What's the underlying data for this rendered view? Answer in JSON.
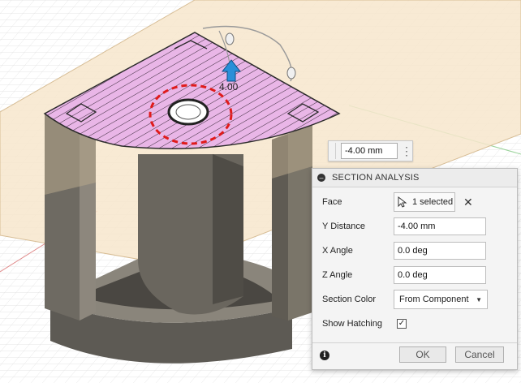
{
  "viewport": {
    "dimension_label": "4.00"
  },
  "distance_input": {
    "value": "-4.00 mm",
    "menu_icon": "vertical-ellipsis-icon"
  },
  "dialog": {
    "title": "SECTION ANALYSIS",
    "face": {
      "label": "Face",
      "selected_text": "1 selected",
      "clear_icon": "close-icon"
    },
    "y_distance": {
      "label": "Y Distance",
      "value": "-4.00 mm"
    },
    "x_angle": {
      "label": "X Angle",
      "value": "0.0 deg"
    },
    "z_angle": {
      "label": "Z Angle",
      "value": "0.0 deg"
    },
    "section_color": {
      "label": "Section Color",
      "value": "From Component"
    },
    "show_hatching": {
      "label": "Show Hatching",
      "checked": true
    },
    "ok_label": "OK",
    "cancel_label": "Cancel"
  },
  "colors": {
    "section_face": "#e8b4e6",
    "plane": "#f7e6cc",
    "body_dark": "#6e6a62",
    "body_tan": "#b8a88c",
    "arrow": "#2a8fd8",
    "highlight_circle": "#e01b1b"
  }
}
